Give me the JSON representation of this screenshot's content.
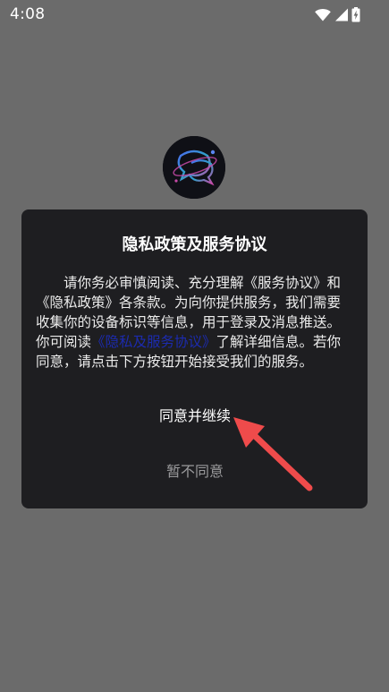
{
  "status_bar": {
    "time": "4:08",
    "icons": [
      "wifi-icon",
      "cell-signal-icon",
      "battery-charging-icon"
    ]
  },
  "app": {
    "logo_icon": "chat-planet-logo"
  },
  "dialog": {
    "title": "隐私政策及服务协议",
    "body_prefix": "请你务必审慎阅读、充分理解《服务协议》和《隐私政策》各条款。为向你提供服务，我们需要收集你的设备标识等信息，用于登录及消息推送。你可阅读",
    "link_text": "《隐私及服务协议》",
    "body_suffix": "了解详细信息。若你同意，请点击下方按钮开始接受我们的服务。",
    "agree_label": "同意并继续",
    "decline_label": "暂不同意"
  },
  "colors": {
    "background": "#6b6b6b",
    "dialog": "#1e1e21",
    "link": "#1c2bb0",
    "annotation_arrow": "#ef4b4b"
  }
}
